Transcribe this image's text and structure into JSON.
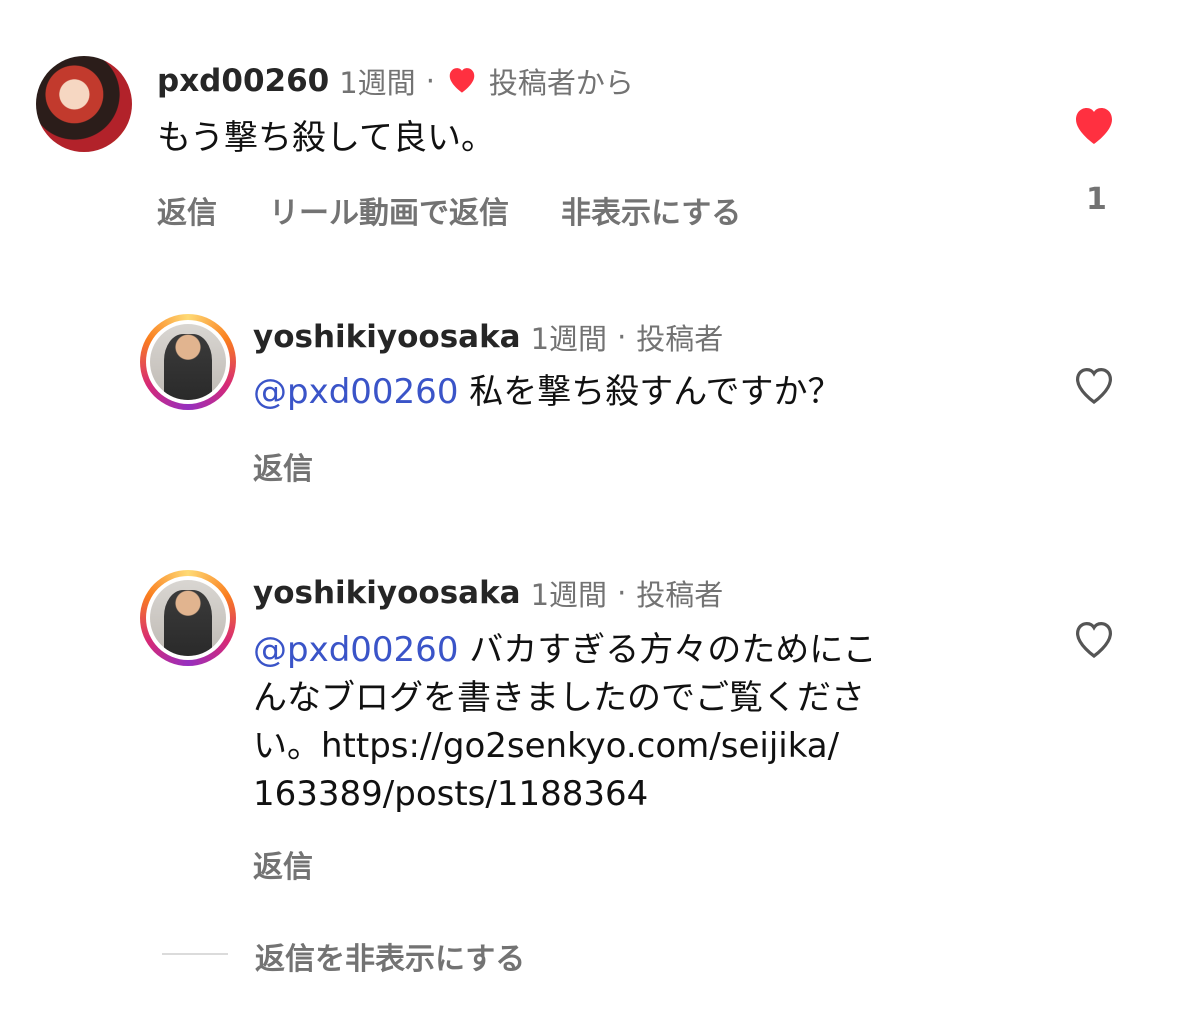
{
  "comment": {
    "username": "pxd00260",
    "time": "1週間",
    "separator": "·",
    "liked_by_author_label": "投稿者から",
    "text": "もう撃ち殺して良い。",
    "like_count": "1",
    "actions": {
      "reply": "返信",
      "reel_reply": "リール動画で返信",
      "hide": "非表示にする"
    }
  },
  "replies": [
    {
      "username": "yoshikiyoosaka",
      "time": "1週間",
      "separator": "·",
      "author_label": "投稿者",
      "mention": "@pxd00260",
      "text": " 私を撃ち殺すんですか？",
      "reply_label": "返信"
    },
    {
      "username": "yoshikiyoosaka",
      "time": "1週間",
      "separator": "·",
      "author_label": "投稿者",
      "mention": "@pxd00260",
      "text_line1": " バカすぎる方々のためにこ",
      "text_line2": "んなブログを書きましたのでご覧くださ",
      "text_line3": "い。https://go2senkyo.com/seijika/",
      "text_line4": "163389/posts/1188364",
      "reply_label": "返信"
    }
  ],
  "hide_replies_label": "返信を非表示にする",
  "colors": {
    "heart_red": "#ff3040",
    "mention_blue": "#3a54c8",
    "meta_gray": "#737373"
  },
  "icons": {
    "liked": "heart-filled-icon",
    "like": "heart-outline-icon"
  }
}
